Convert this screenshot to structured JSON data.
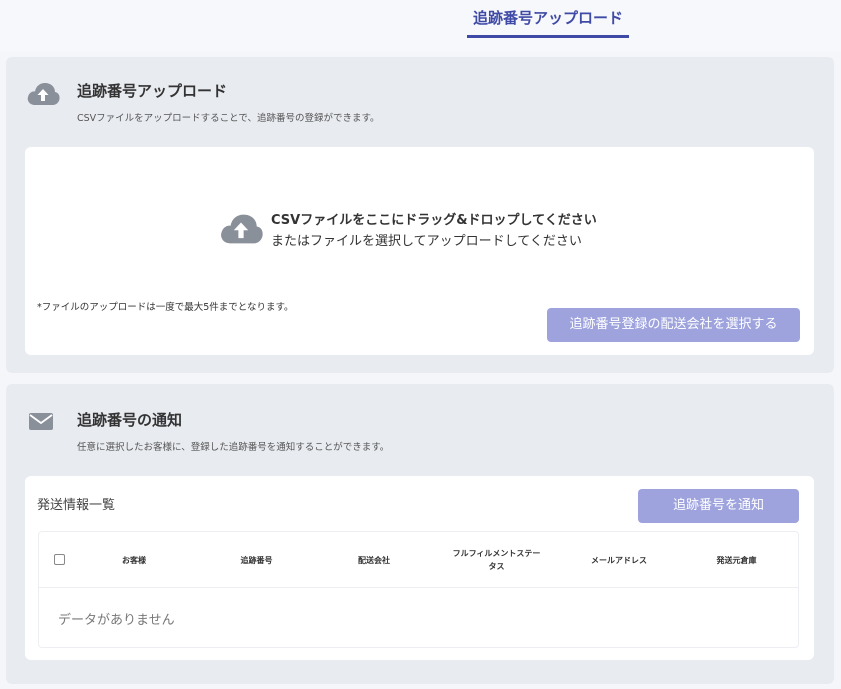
{
  "tabs": [
    {
      "label": "追跡番号アップロード",
      "active": true
    }
  ],
  "upload_section": {
    "icon": "cloud-upload-icon",
    "title": "追跡番号アップロード",
    "description": "CSVファイルをアップロードすることで、追跡番号の登録ができます。",
    "dropzone": {
      "icon": "cloud-upload-icon",
      "line1": "CSVファイルをここにドラッグ&ドロップしてください",
      "line2": "またはファイルを選択してアップロードしてください"
    },
    "note": "*ファイルのアップロードは一度で最大5件までとなります。",
    "select_carrier_button": "追跡番号登録の配送会社を選択する"
  },
  "notify_section": {
    "icon": "mail-icon",
    "title": "追跡番号の通知",
    "description": "任意に選択したお客様に、登録した追跡番号を通知することができます。",
    "list_title": "発送情報一覧",
    "notify_button": "追跡番号を通知",
    "table": {
      "columns": [
        "お客様",
        "追跡番号",
        "配送会社",
        "フルフィルメントステータス",
        "メールアドレス",
        "発送元倉庫"
      ],
      "empty_text": "データがありません"
    }
  },
  "colors": {
    "accent": "#3f4aa6",
    "button_disabled": "#9ea3de",
    "panel_bg": "#e8ebf0",
    "icon_gray": "#8a909a"
  }
}
